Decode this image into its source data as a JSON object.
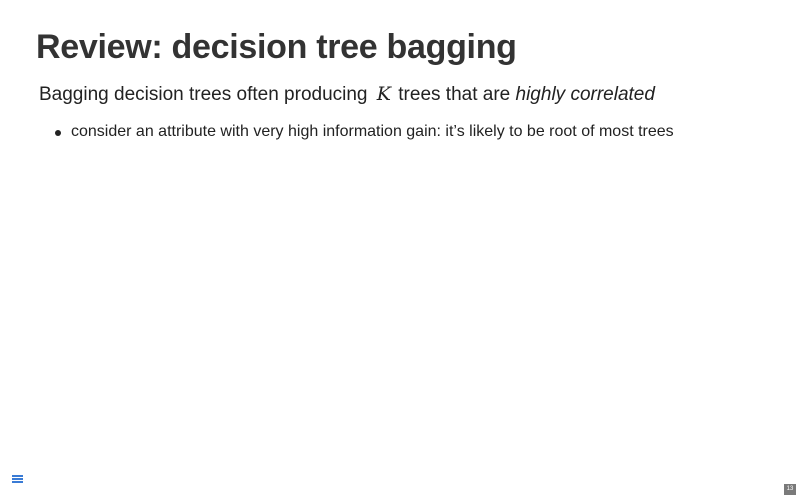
{
  "slide": {
    "title": "Review: decision tree bagging",
    "lead": {
      "text_before": "Bagging decision trees often producing",
      "math_symbol": "K",
      "text_after": "trees that are",
      "emphasis": "highly correlated"
    },
    "bullets": [
      "consider an attribute with very high information gain: it’s likely to be root of most trees"
    ]
  },
  "controls": {
    "menu_icon": "hamburger-menu-icon",
    "page_number": "13"
  },
  "colors": {
    "title": "#333333",
    "text": "#222222",
    "menu_accent": "#3a7bd5",
    "page_badge": "#7a7a7a"
  }
}
